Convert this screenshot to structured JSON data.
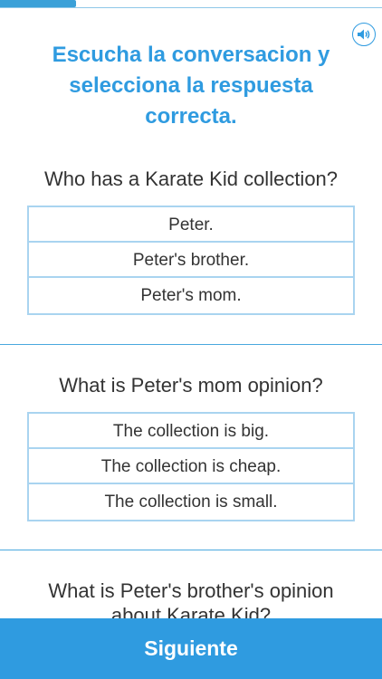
{
  "progress": {
    "fraction": 0.2
  },
  "audio": {
    "icon": "speaker-icon"
  },
  "header": {
    "instruction": "Escucha la conversacion y selecciona la respuesta correcta."
  },
  "questions": [
    {
      "text": "Who has a Karate Kid collection?",
      "options": [
        "Peter.",
        "Peter's brother.",
        "Peter's mom."
      ]
    },
    {
      "text": "What is Peter's mom opinion?",
      "options": [
        "The collection is big.",
        "The collection is cheap.",
        "The collection is small."
      ]
    },
    {
      "text_line1": "What is Peter's brother's opinion",
      "text_line2": "about Karate Kid?"
    }
  ],
  "footer": {
    "next_label": "Siguiente"
  },
  "colors": {
    "accent": "#2f9be0",
    "option_border": "#a9d4f0",
    "text": "#333333"
  }
}
